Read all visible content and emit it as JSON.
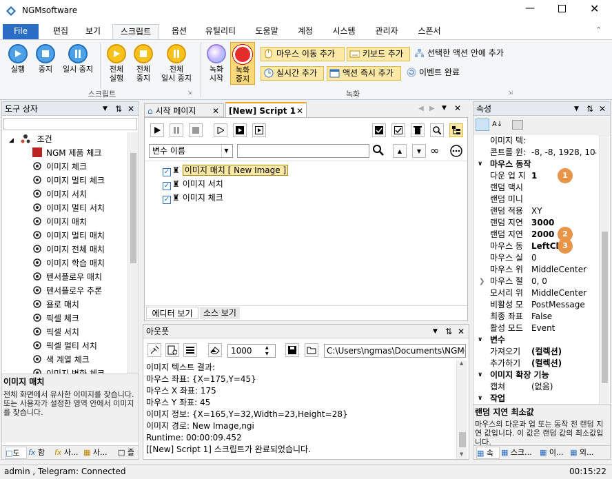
{
  "window": {
    "title": "NGMsoftware"
  },
  "menu": {
    "file": "File",
    "tabs": [
      "편집",
      "보기",
      "스크립트",
      "옵션",
      "유틸리티",
      "도움말",
      "계정",
      "시스템",
      "관리자",
      "스폰서"
    ],
    "active": "스크립트"
  },
  "ribbon": {
    "script_group": "스크립트",
    "record_group": "녹화",
    "run": "실행",
    "stop": "중지",
    "pause": "일시 중지",
    "run_all_1": "전체",
    "run_all_2": "실행",
    "stop_all_1": "전체",
    "stop_all_2": "중지",
    "pause_all_1": "전체",
    "pause_all_2": "일시 중지",
    "rec_start_1": "녹화",
    "rec_start_2": "시작",
    "rec_stop_1": "녹화",
    "rec_stop_2": "중지",
    "mouse_move": "마우스 이동 추가",
    "keyboard": "키보드 추가",
    "selected_action": "선택한 액션 안에 추가",
    "realtime": "실시간 추가",
    "action_now": "액션 즉시 추가",
    "event_done": "이벤트 완료"
  },
  "toolbox": {
    "title": "도구 상자",
    "search_placeholder": "",
    "category": "조건",
    "items": [
      "NGM 제품 체크",
      "이미지 체크",
      "이미지 멀티 체크",
      "이미지 서치",
      "이미지 멀티 서치",
      "이미지 매치",
      "이미지 멀티 매치",
      "이미지 전체 매치",
      "이미지 학습 매치",
      "텐서플로우 매치",
      "텐서플로우 추론",
      "욜로 매치",
      "픽셀 체크",
      "픽셀 서치",
      "픽셀 멀티 서치",
      "색 계열 체크",
      "이미지 변화 체크"
    ],
    "desc_title": "이미지 매치",
    "desc_text": "전체 화면에서 유사한 이미지를 찾습니다. 또는 사용자가 설정한 영역 안에서 이미지를 찾습니다.",
    "bottom_tabs": [
      "도",
      "함",
      "사...",
      "사...",
      "즐"
    ]
  },
  "editor": {
    "tab_start": "시작 페이지",
    "tab_script": "[New] Script 1",
    "var_dropdown": "변수 이름",
    "var_input": "",
    "nodes": [
      {
        "label": "이미지 매치 [ New Image ]",
        "selected": true
      },
      {
        "label": "이미지 서치",
        "selected": false
      },
      {
        "label": "이미지 체크",
        "selected": false
      }
    ],
    "view_editor": "에디터 보기",
    "view_source": "소스 보기"
  },
  "output": {
    "title": "아웃풋",
    "count": "1000",
    "path": "C:\\Users\\ngmas\\Documents\\NGM6\\",
    "lines": [
      "이미지 텍스트 결과:",
      "마우스 좌표: {X=175,Y=45}",
      "마우스 X 좌표: 175",
      "마우스 Y 좌표: 45",
      "이미지 정보: {X=165,Y=32,Width=23,Height=28}",
      "이미지 경로: New Image,ngi",
      "Runtime: 00:00:09.452",
      "[[New] Script 1] 스크립트가 완료되었습니다."
    ]
  },
  "props": {
    "title": "속성",
    "rows_top": [
      {
        "name": "이미지 텍:",
        "val": ""
      },
      {
        "name": "콘트롤 윈:",
        "val": "-8, -8, 1928, 1048"
      }
    ],
    "cat_mouse": "마우스 동작",
    "rows_mouse": [
      {
        "name": "다운 업 지",
        "val": "1",
        "bold": true
      },
      {
        "name": "랜덤 맥시",
        "val": "",
        "bold": false
      },
      {
        "name": "랜덤 미니",
        "val": "",
        "bold": false
      },
      {
        "name": "랜덤 적용",
        "val": "XY",
        "bold": false
      },
      {
        "name": "랜덤 지연",
        "val": "3000",
        "bold": true
      },
      {
        "name": "랜덤 지연",
        "val": "2000",
        "bold": true
      },
      {
        "name": "마우스 동",
        "val": "LeftClick",
        "bold": true
      },
      {
        "name": "마우스 실",
        "val": "0",
        "bold": false
      },
      {
        "name": "마우스 위",
        "val": "MiddleCenter",
        "bold": false
      },
      {
        "name": "마우스 절",
        "val": "0, 0",
        "bold": false
      },
      {
        "name": "모서리 위",
        "val": "MiddleCenter",
        "bold": false
      },
      {
        "name": "비활성 모",
        "val": "PostMessage",
        "bold": false
      },
      {
        "name": "최종 좌표",
        "val": "False",
        "bold": false
      },
      {
        "name": "활성 모드",
        "val": "Event",
        "bold": false
      }
    ],
    "cat_var": "변수",
    "rows_var": [
      {
        "name": "가져오기",
        "val": "(컬렉션)",
        "bold": true
      },
      {
        "name": "추가하기",
        "val": "(컬렉션)",
        "bold": true
      }
    ],
    "cat_img": "이미지 확장 기능",
    "rows_img": [
      {
        "name": "캡쳐",
        "val": "(없음)",
        "bold": false
      }
    ],
    "cat_action": "작업",
    "badges": [
      "1",
      "2",
      "3"
    ],
    "desc_title": "랜덤 지연 최소값",
    "desc_text": "마우스의 다운과 업 또는 동작 전 랜덤 지연 값입니다. 이 값은 랜덤 값의 최소값입니다.",
    "bottom_tabs": [
      "속",
      "스크...",
      "이...",
      "외..."
    ]
  },
  "status": {
    "left": "admin , Telegram: Connected",
    "time": "00:15:22"
  }
}
